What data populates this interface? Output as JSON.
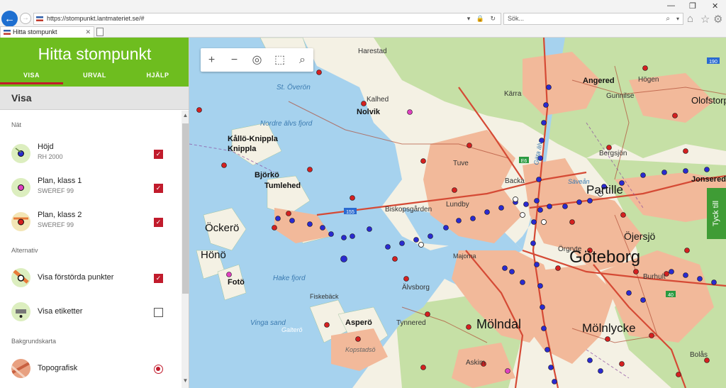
{
  "browser": {
    "url": "https://stompunkt.lantmateriet.se/#",
    "search_placeholder": "Sök...",
    "tab_title": "Hitta stompunkt"
  },
  "panel": {
    "title": "Hitta stompunkt",
    "tabs": [
      "VISA",
      "URVAL",
      "HJÄLP"
    ],
    "section_title": "Visa",
    "groups": {
      "nat": "Nät",
      "alternativ": "Alternativ",
      "bakgrund": "Bakgrundskarta"
    },
    "items": [
      {
        "title": "Höjd",
        "subtitle": "RH 2000",
        "checked": true
      },
      {
        "title": "Plan, klass 1",
        "subtitle": "SWEREF 99",
        "checked": true
      },
      {
        "title": "Plan, klass 2",
        "subtitle": "SWEREF 99",
        "checked": true
      },
      {
        "title": "Visa förstörda punkter",
        "checked": true
      },
      {
        "title": "Visa etiketter",
        "checked": false
      },
      {
        "title": "Topografisk",
        "selected": true
      }
    ]
  },
  "feedback_label": "Tyck till",
  "map_labels": [
    "Harestad",
    "St. Överön",
    "Kalhed",
    "Nolvik",
    "Nordre älvs fjord",
    "Kållö-Knippla",
    "Knippla",
    "Björkö",
    "Tumlehed",
    "Tuve",
    "Biskopsgården",
    "Lundby",
    "Backa",
    "Kärra",
    "Angered",
    "Gunnilse",
    "Högen",
    "Olofstorp",
    "Bergsjön",
    "Partille",
    "Jonsered",
    "Säveån",
    "Öckerö",
    "Hönö",
    "Fotö",
    "Hake fjord",
    "Majorna",
    "Örgryte",
    "Göteborg",
    "Öjersjö",
    "Älvsborg",
    "Burhult",
    "Vinga sand",
    "Galterö",
    "Asperö",
    "Tynnered",
    "Mölndal",
    "Mölnlycke",
    "Kopstadsö",
    "Askim",
    "Bolås",
    "Göta älv",
    "Fiskebäck"
  ],
  "road_numbers": [
    "155",
    "E6",
    "190",
    "40"
  ],
  "colors": {
    "header_green": "#6ebd1f",
    "accent_red": "#c11b2c",
    "water": "#a6d2ee",
    "urban": "#f2b99a",
    "forest": "#c6e0a6",
    "point_blue": "#2a2ad0",
    "point_red": "#d42020",
    "point_magenta": "#e040c0"
  },
  "icons": {
    "map_controls": [
      "zoom-in-icon",
      "zoom-out-icon",
      "locate-icon",
      "select-area-icon",
      "search-icon"
    ]
  }
}
